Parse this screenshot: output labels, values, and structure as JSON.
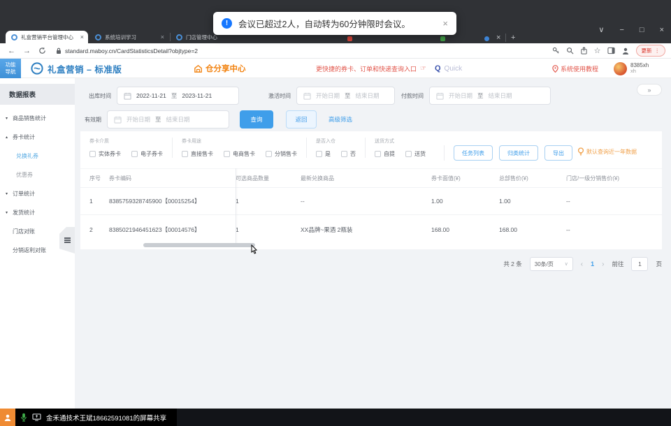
{
  "browser": {
    "tabs": [
      {
        "label": "礼盒营销平台管理中心"
      },
      {
        "label": "系统培训学习"
      },
      {
        "label": "门店管理中心"
      }
    ],
    "close_glyph": "×",
    "new_tab_glyph": "+",
    "url": "standard.maboy.cn/CardStatisticsDetail?objtype=2",
    "update_button": "更新",
    "more_glyph": "⋮",
    "window_controls": {
      "menu": "∨",
      "minimize": "−",
      "maximize": "□",
      "close": "×"
    }
  },
  "toast": {
    "message": "会议已超过2人，自动转为60分钟限时会议。",
    "close_glyph": "×"
  },
  "header": {
    "nav_toggle_line1": "功能",
    "nav_toggle_line2": "导航",
    "brand": "礼盒营销 – 标准版",
    "share_center": "仓分享中心",
    "quick_entry_text": "更快捷的券卡、订单和快递查询入口",
    "hand_glyph": "☞",
    "search_q": "Q",
    "search_placeholder": "Quick",
    "tutorial": "系统使用教程",
    "username": "8385xh",
    "user_sub": "xh"
  },
  "sidebar": {
    "section_title": "数据报表",
    "items": [
      {
        "label": "商品销售统计",
        "arrow": "▾"
      },
      {
        "label": "券卡统计",
        "arrow": "▴"
      },
      {
        "label": "兑换礼券",
        "arrow": ""
      },
      {
        "label": "优惠券",
        "arrow": ""
      },
      {
        "label": "订单统计",
        "arrow": "▾"
      },
      {
        "label": "发货统计",
        "arrow": "▾"
      },
      {
        "label": "门店对账",
        "arrow": ""
      },
      {
        "label": "分销返利对账",
        "arrow": ""
      }
    ]
  },
  "filters": {
    "outbound_label": "出库时间",
    "outbound_start": "2022-11-21",
    "outbound_end": "2023-11-21",
    "to_label": "至",
    "activate_label": "激活时间",
    "pay_label": "付款时间",
    "valid_label": "有效期",
    "start_placeholder": "开始日期",
    "end_placeholder": "结束日期",
    "query_button": "查询",
    "back_button": "返回",
    "advanced_link": "高级筛选",
    "collapse_glyph": "»"
  },
  "filter_groups": [
    {
      "title": "券卡介质",
      "options": [
        "实体券卡",
        "电子券卡"
      ]
    },
    {
      "title": "券卡用途",
      "options": [
        "直接售卡",
        "电商售卡",
        "分销售卡"
      ]
    },
    {
      "title": "是否入仓",
      "options": [
        "是",
        "否"
      ]
    },
    {
      "title": "送货方式",
      "options": [
        "自提",
        "送货"
      ]
    }
  ],
  "actions": {
    "task_list": "任务列表",
    "classify_stats": "归类统计",
    "export": "导出",
    "tip": "默认查询近一年数据"
  },
  "table": {
    "columns": [
      "序号",
      "券卡编码",
      "可选商品数量",
      "最新兑换商品",
      "券卡面值(¥)",
      "总部售价(¥)",
      "门店/一级分销售价(¥)"
    ],
    "rows": [
      [
        "1",
        "8385759328745900【00015254】",
        "1",
        "--",
        "1.00",
        "1.00",
        "--"
      ],
      [
        "2",
        "8385021946451623【00014576】",
        "1",
        "XX品牌~果酒 2瓶装",
        "168.00",
        "168.00",
        "--"
      ]
    ]
  },
  "pagination": {
    "total": "共 2 条",
    "page_size": "30条/页",
    "caret": "∨",
    "prev": "‹",
    "page": "1",
    "next": "›",
    "goto_label": "前往",
    "goto_value": "1",
    "page_unit": "页"
  },
  "screen_share": {
    "label": "金禾通技术王斌18662591081的屏幕共享"
  },
  "colors": {
    "accent_blue": "#3f9eea",
    "brand_blue": "#2e7fc1",
    "brand_orange": "#f2820f",
    "alert_red": "#e2574c",
    "tip_orange": "#f0a14b",
    "toast_info_blue": "#1677ff"
  }
}
